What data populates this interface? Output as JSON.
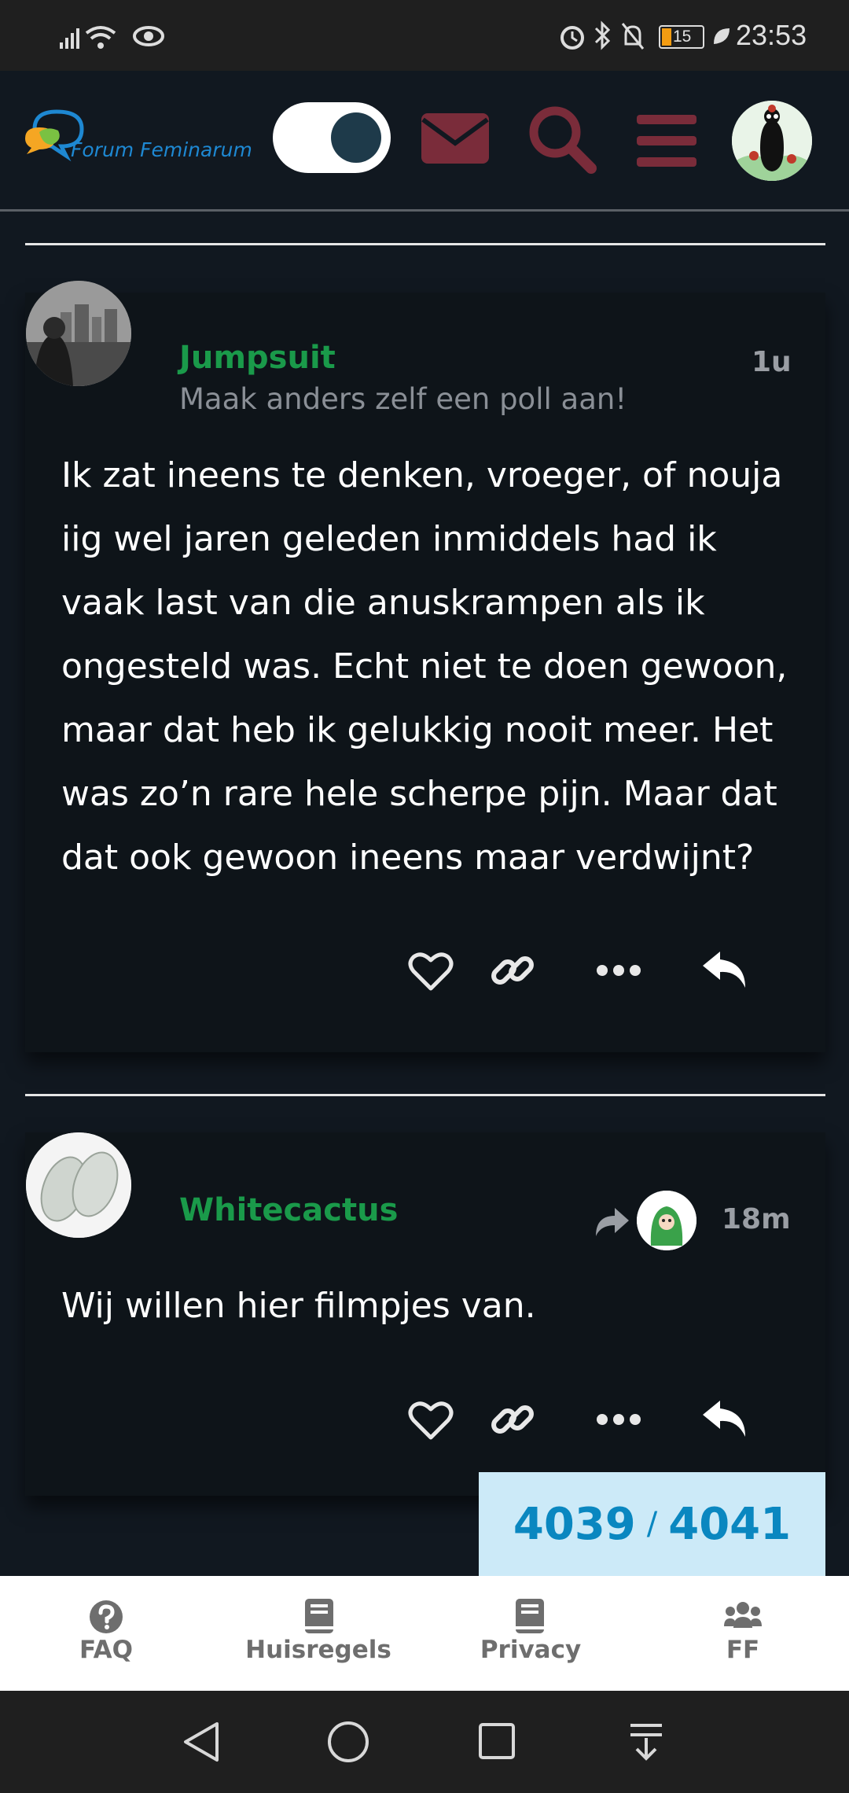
{
  "status_bar": {
    "battery": "15",
    "time": "23:53"
  },
  "header": {
    "logo_text": "Forum Feminarum",
    "icons": [
      "toggle-switch",
      "envelope-icon",
      "search-icon",
      "menu-icon",
      "avatar"
    ]
  },
  "posts": [
    {
      "username": "Jumpsuit",
      "user_title": "Maak anders zelf een poll aan!",
      "age": "1u",
      "lines": [
        "Ik zat ineens te denken, vroeger, of nouja",
        "iig wel jaren geleden inmiddels had ik",
        "vaak last van die anuskrampen als ik",
        "ongesteld was. Echt niet te doen gewoon,",
        "maar dat heb ik gelukkig nooit meer. Het",
        "was zo’n rare hele scherpe pijn. Maar dat",
        "dat ook gewoon ineens maar verdwijnt?"
      ]
    },
    {
      "username": "Whitecactus",
      "age": "18m",
      "text": "Wij willen hier filmpjes van."
    }
  ],
  "post_actions": [
    "heart-icon",
    "link-icon",
    "more-icon",
    "reply-icon"
  ],
  "counter": {
    "current": "4039",
    "separator": "/",
    "total": "4041"
  },
  "bottom_nav": [
    {
      "label": "FAQ",
      "icon": "question-icon"
    },
    {
      "label": "Huisregels",
      "icon": "book-icon"
    },
    {
      "label": "Privacy",
      "icon": "book-icon"
    },
    {
      "label": "FF",
      "icon": "users-icon"
    }
  ],
  "colors": {
    "background": "#111820",
    "username": "#1a9a4a",
    "header_icons": "#7a2c3a",
    "counter_bg": "#cceaf8",
    "counter_text": "#0a87c0"
  }
}
